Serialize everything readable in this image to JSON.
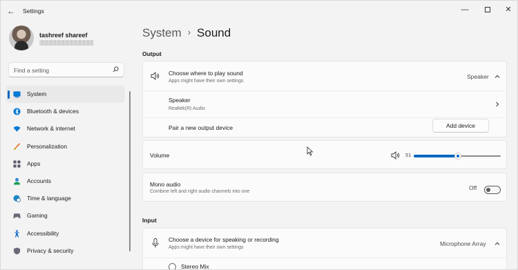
{
  "window": {
    "title": "Settings",
    "controls": {
      "minimize": "—",
      "close": "✕"
    }
  },
  "profile": {
    "name": "tashreef shareef"
  },
  "search": {
    "placeholder": "Find a setting"
  },
  "sidebar": {
    "items": [
      {
        "label": "System",
        "icon": "system-icon",
        "active": true
      },
      {
        "label": "Bluetooth & devices",
        "icon": "bluetooth-icon"
      },
      {
        "label": "Network & internet",
        "icon": "wifi-icon"
      },
      {
        "label": "Personalization",
        "icon": "brush-icon"
      },
      {
        "label": "Apps",
        "icon": "apps-icon"
      },
      {
        "label": "Accounts",
        "icon": "person-icon"
      },
      {
        "label": "Time & language",
        "icon": "globe-clock-icon"
      },
      {
        "label": "Gaming",
        "icon": "gamepad-icon"
      },
      {
        "label": "Accessibility",
        "icon": "accessibility-icon"
      },
      {
        "label": "Privacy & security",
        "icon": "shield-icon"
      }
    ]
  },
  "breadcrumb": {
    "parent": "System",
    "separator": "›",
    "current": "Sound"
  },
  "output": {
    "heading": "Output",
    "choose": {
      "title": "Choose where to play sound",
      "subtitle": "Apps might have their own settings",
      "value": "Speaker"
    },
    "device": {
      "title": "Speaker",
      "subtitle": "Realtek(R) Audio"
    },
    "pair": {
      "title": "Pair a new output device",
      "button": "Add device"
    },
    "volume": {
      "label": "Volume",
      "value": "51",
      "level": 0.51
    },
    "mono": {
      "title": "Mono audio",
      "subtitle": "Combine left and right audio channels into one",
      "state": "Off"
    }
  },
  "input": {
    "heading": "Input",
    "choose": {
      "title": "Choose a device for speaking or recording",
      "subtitle": "Apps might have their own settings",
      "value": "Microphone Array"
    },
    "device": {
      "title": "Stereo Mix"
    }
  },
  "colors": {
    "accent": "#0067c0",
    "background": "#f3f3f3",
    "card": "#fbfbfb"
  }
}
